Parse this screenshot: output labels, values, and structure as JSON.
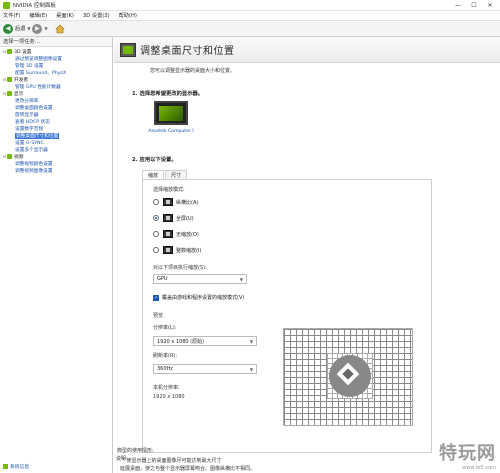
{
  "window": {
    "title": "NVIDIA 控制面板"
  },
  "menu": [
    "文件(F)",
    "编辑(E)",
    "桌面(K)",
    "3D 设置(3)",
    "帮助(H)"
  ],
  "toolbar": {
    "back_label": "后退"
  },
  "task_pane": {
    "header": "选择一项任务...",
    "tree": [
      {
        "label": "3D 设置",
        "type": "cat"
      },
      {
        "label": "通过预览调整图像设置",
        "type": "child"
      },
      {
        "label": "管理 3D 设置",
        "type": "child"
      },
      {
        "label": "配置 Surround、PhysX",
        "type": "child"
      },
      {
        "label": "开发者",
        "type": "cat"
      },
      {
        "label": "管理 GPU 性能计数器",
        "type": "child"
      },
      {
        "label": "显示",
        "type": "cat"
      },
      {
        "label": "更改分辨率",
        "type": "child"
      },
      {
        "label": "调整桌面颜色设置",
        "type": "child"
      },
      {
        "label": "旋转显示器",
        "type": "child"
      },
      {
        "label": "查看 HDCP 状态",
        "type": "child"
      },
      {
        "label": "设置数字音频",
        "type": "child"
      },
      {
        "label": "调整桌面尺寸和位置",
        "type": "child",
        "selected": true
      },
      {
        "label": "设置 G-SYNC",
        "type": "child"
      },
      {
        "label": "设置多个显示器",
        "type": "child"
      },
      {
        "label": "视频",
        "type": "cat"
      },
      {
        "label": "调整视频颜色设置",
        "type": "child"
      },
      {
        "label": "调整视频图像设置",
        "type": "child"
      }
    ],
    "system_info_label": "系统信息"
  },
  "page": {
    "title": "调整桌面尺寸和位置",
    "description": "您可以调整显示器的桌面大小和位置。",
    "step1": "1.  选择您希望更改的显示器。",
    "monitor_label": "Asustek Computer I",
    "step2": "2.  应用以下设置。",
    "tabs": [
      "缩放",
      "尺寸"
    ],
    "scaling_mode_label": "选择缩放模式:",
    "modes": [
      {
        "label": "纵横比(A)",
        "selected": false
      },
      {
        "label": "全屏(U)",
        "selected": true
      },
      {
        "label": "无缩放(O)",
        "selected": false
      },
      {
        "label": "整数缩放(I)",
        "selected": false
      }
    ],
    "perform_on_label": "对以下项目执行缩放(S):",
    "perform_on_value": "GPU",
    "override_label": "覆盖由游戏和程序设置的缩放模式(V)",
    "preview_label": "预览",
    "resolution_label": "分辨率(L):",
    "resolution_value": "1920 x 1080 (原始)",
    "refresh_label": "刷新率(R):",
    "refresh_value": "360Hz",
    "native_label": "本机分辨率:",
    "native_value": "1920 x 1080"
  },
  "notes": {
    "title": "说明:",
    "line1": "延展桌面，使之与整个显示器屏幕吻合。图像纵横比不相同。",
    "typical_title": "典型的使用情形:",
    "typical_item": "使显示器上的桌面图像尽可能达到最大尺寸"
  },
  "watermark": {
    "main": "特玩网",
    "sub": "www.te5.com"
  }
}
